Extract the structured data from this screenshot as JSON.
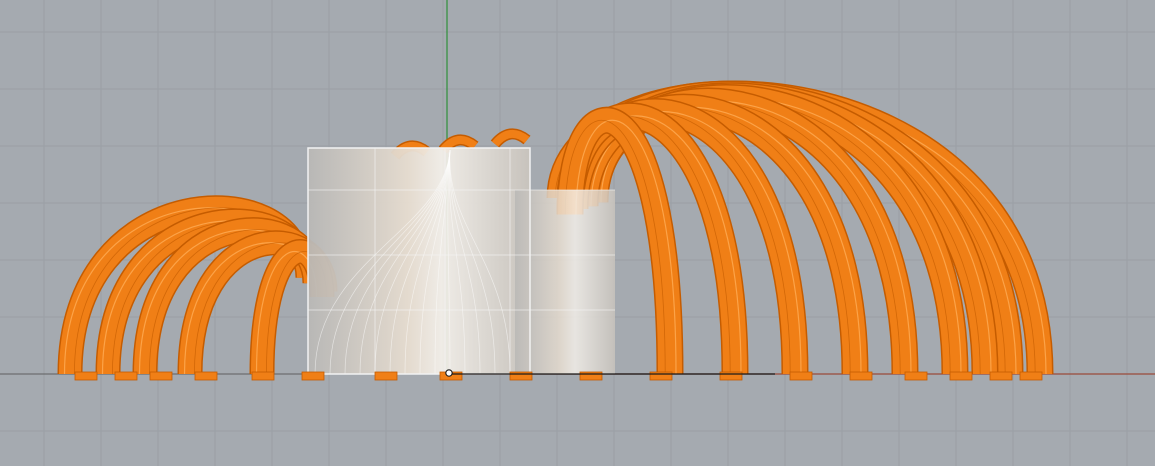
{
  "viewport": {
    "background": "#a5aab0",
    "grid_minor": "#9a9fa5",
    "grid_major": "#8f949a",
    "x_axis_color": "#9b4a3a",
    "y_axis_color": "#2f8f3a"
  },
  "model": {
    "ribs_color": "#f07f16",
    "ribs_edge_color": "#c55c00",
    "ribs_highlight_color": "#ffad55",
    "box_fill": "#d6d2cc",
    "box_edge": "#f2f2f2",
    "selected": true
  },
  "icons": {
    "gumball": "gumball-icon"
  }
}
